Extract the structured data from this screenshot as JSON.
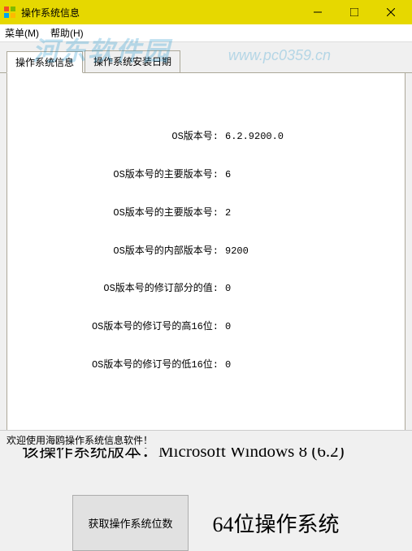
{
  "window": {
    "title": "操作系统信息"
  },
  "menu": {
    "menu1": "菜单(M)",
    "menu2": "帮助(H)"
  },
  "watermark": {
    "text": "河东软件园",
    "url": "www.pc0359.cn"
  },
  "tabs": {
    "tab1": "操作系统信息",
    "tab2": "操作系统安装日期"
  },
  "info": {
    "row1_label": "OS版本号:",
    "row1_value": "6.2.9200.0",
    "row2_label": "OS版本号的主要版本号:",
    "row2_value": "6",
    "row3_label": "OS版本号的主要版本号:",
    "row3_value": "2",
    "row4_label": "OS版本号的内部版本号:",
    "row4_value": "9200",
    "row5_label": "OS版本号的修订部分的值:",
    "row5_value": "0",
    "row6_label": "OS版本号的修订号的高16位:",
    "row6_value": "0",
    "row7_label": "OS版本号的修订号的低16位:",
    "row7_value": "0"
  },
  "os_version_text": "该操作系统版本：Microsoft Windows 8 (6.2)",
  "bits_button": "获取操作系统位数",
  "bits_text": "64位操作系统",
  "statusbar": "欢迎使用海鸥操作系统信息软件！"
}
